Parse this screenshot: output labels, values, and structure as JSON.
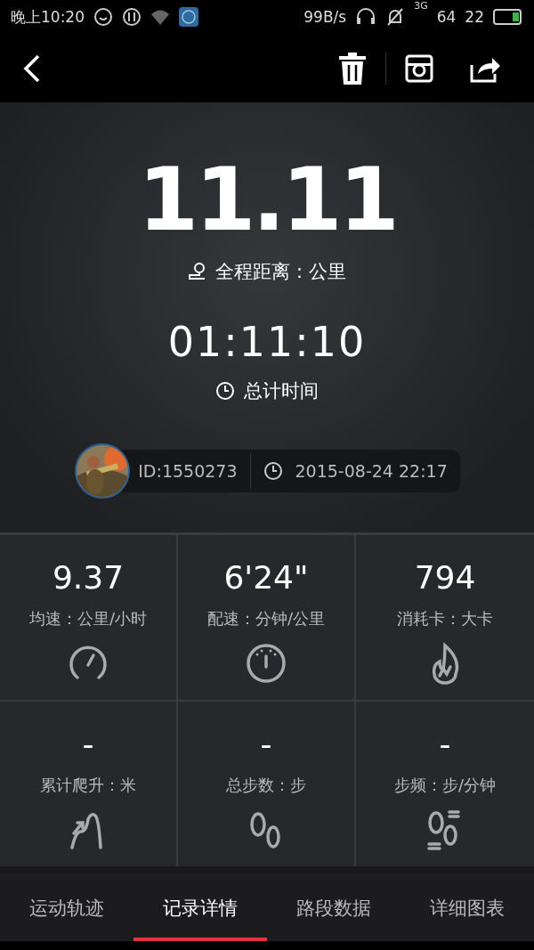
{
  "status_bar": {
    "time": "晚上10:20",
    "net_speed": "99B/s",
    "network": "3G",
    "signal": "64",
    "battery": "22"
  },
  "summary": {
    "distance": "11.11",
    "distance_label": "全程距离：公里",
    "duration": "01:11:10",
    "duration_label": "总计时间",
    "user_id": "ID:1550273",
    "date": "2015-08-24 22:17"
  },
  "stats": [
    {
      "kind": "speed",
      "value": "9.37",
      "label": "均速：公里/小时"
    },
    {
      "kind": "pace",
      "value": "6'24\"",
      "label": "配速：分钟/公里"
    },
    {
      "kind": "calories",
      "value": "794",
      "label": "消耗卡：大卡"
    },
    {
      "kind": "climb",
      "value": "-",
      "label": "累计爬升：米"
    },
    {
      "kind": "steps",
      "value": "-",
      "label": "总步数：步"
    },
    {
      "kind": "cadence",
      "value": "-",
      "label": "步频：步/分钟"
    }
  ],
  "tabs": [
    {
      "label": "运动轨迹",
      "selected": false
    },
    {
      "label": "记录详情",
      "selected": true
    },
    {
      "label": "路段数据",
      "selected": false
    },
    {
      "label": "详细图表",
      "selected": false
    }
  ]
}
